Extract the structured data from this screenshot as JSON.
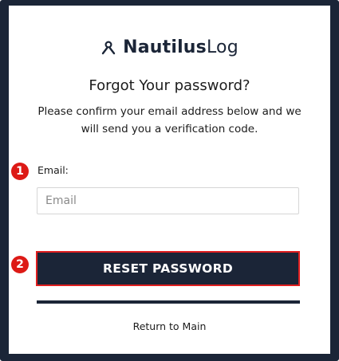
{
  "brand": {
    "name_bold": "Nautilus",
    "name_light": "Log",
    "icon": "person-icon"
  },
  "heading": {
    "title": "Forgot Your password?",
    "description": "Please confirm your email address below and we will send you a verification code."
  },
  "markers": {
    "email_marker": "1",
    "button_marker": "2"
  },
  "form": {
    "email_label": "Email:",
    "email_placeholder": "Email",
    "email_value": ""
  },
  "actions": {
    "reset_label": "RESET PASSWORD",
    "return_label": "Return to Main"
  },
  "colors": {
    "navy": "#1b2537",
    "marker_red": "#dd1a16",
    "button_border": "#e01f1f"
  }
}
